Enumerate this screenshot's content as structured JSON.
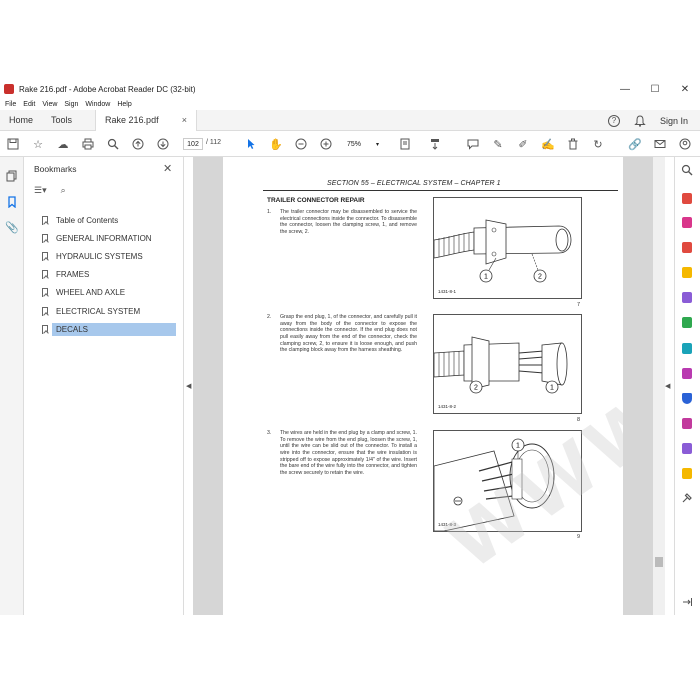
{
  "window": {
    "title": "Rake 216.pdf - Adobe Acrobat Reader DC (32-bit)",
    "minimize": "—",
    "maximize": "☐",
    "close": "✕"
  },
  "menu": [
    "File",
    "Edit",
    "View",
    "Sign",
    "Window",
    "Help"
  ],
  "tabs": {
    "home": "Home",
    "tools": "Tools",
    "document": "Rake 216.pdf",
    "close": "×",
    "help": "?",
    "sign_in": "Sign In"
  },
  "toolbar": {
    "page_current": "102",
    "page_total": "/ 112",
    "zoom": "75%"
  },
  "bookmarks": {
    "title": "Bookmarks",
    "close": "✕",
    "items": [
      {
        "label": "Table of Contents"
      },
      {
        "label": "GENERAL INFORMATION"
      },
      {
        "label": "HYDRAULIC SYSTEMS"
      },
      {
        "label": "FRAMES"
      },
      {
        "label": "WHEEL AND AXLE"
      },
      {
        "label": "ELECTRICAL SYSTEM"
      },
      {
        "label": "DECALS"
      }
    ],
    "selected_index": 6
  },
  "document": {
    "section_header": "SECTION 55 – ELECTRICAL SYSTEM – CHAPTER 1",
    "heading": "TRAILER CONNECTOR REPAIR",
    "watermark": "WWW.EPCDEPO.COM",
    "steps": [
      {
        "num": "1.",
        "text": "The trailer connector may be disassembled to service the electrical connections inside the connector. To disassemble the connector, loosen the clamping screw, 1, and remove the screw, 2."
      },
      {
        "num": "2.",
        "text": "Grasp the end plug, 1, of the connector, and carefully pull it away from the body of the connector to expose the connections inside the connector. If the end plug does not pull easily away from the end of the connector, check the clamping screw, 2, to ensure it is loose enough, and push the clamping block away from the harness sheathing."
      },
      {
        "num": "3.",
        "text": "The wires are held in the end plug by a clamp and screw, 1. To remove the wire from the end plug, loosen the screw, 1, until the wire can be slid out of the connector. To install a wire into the connector, ensure that the wire insulation is stripped off to expose approximately 1/4\" of the wire. Insert the bare end of the wire fully into the connector, and tighten the screw securely to retain the wire."
      }
    ],
    "figures": [
      {
        "code": "1431-8-1",
        "num": "7",
        "callouts": [
          "1",
          "2"
        ]
      },
      {
        "code": "1431-8-2",
        "num": "8",
        "callouts": [
          "2",
          "1"
        ]
      },
      {
        "code": "1431-8-3",
        "num": "9",
        "callouts": [
          "1"
        ]
      }
    ]
  },
  "colors": {
    "accent": "#1473e6",
    "selection": "#a7c8ec",
    "doc_background": "#d6d6d6"
  }
}
